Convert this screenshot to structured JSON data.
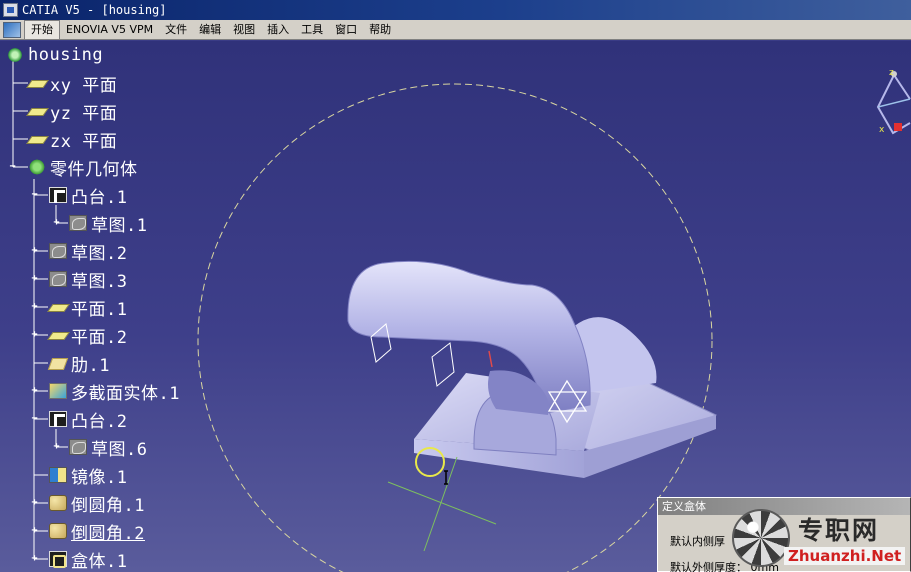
{
  "window": {
    "title": "CATIA V5 - [housing]"
  },
  "menu": {
    "items": [
      {
        "label": "开始",
        "active": true
      },
      {
        "label": "ENOVIA V5 VPM",
        "active": false
      },
      {
        "label": "文件",
        "active": false
      },
      {
        "label": "编辑",
        "active": false
      },
      {
        "label": "视图",
        "active": false
      },
      {
        "label": "插入",
        "active": false
      },
      {
        "label": "工具",
        "active": false
      },
      {
        "label": "窗口",
        "active": false
      },
      {
        "label": "帮助",
        "active": false
      }
    ]
  },
  "tree": {
    "root": "housing",
    "items": [
      {
        "label": "xy 平面",
        "icon": "plane-icon"
      },
      {
        "label": "yz 平面",
        "icon": "plane-icon"
      },
      {
        "label": "zx 平面",
        "icon": "plane-icon"
      },
      {
        "label": "零件几何体",
        "icon": "part-body-icon"
      },
      {
        "label": "凸台.1",
        "icon": "pad-icon"
      },
      {
        "label": "草图.1",
        "icon": "sketch-icon"
      },
      {
        "label": "草图.2",
        "icon": "sketch-icon"
      },
      {
        "label": "草图.3",
        "icon": "sketch-icon"
      },
      {
        "label": "平面.1",
        "icon": "plane-icon"
      },
      {
        "label": "平面.2",
        "icon": "plane-icon"
      },
      {
        "label": "肋.1",
        "icon": "rib-icon"
      },
      {
        "label": "多截面实体.1",
        "icon": "multi-section-solid-icon"
      },
      {
        "label": "凸台.2",
        "icon": "pad-icon"
      },
      {
        "label": "草图.6",
        "icon": "sketch-icon"
      },
      {
        "label": "镜像.1",
        "icon": "mirror-icon"
      },
      {
        "label": "倒圆角.1",
        "icon": "fillet-icon"
      },
      {
        "label": "倒圆角.2",
        "icon": "fillet-icon"
      },
      {
        "label": "盒体.1",
        "icon": "shell-icon"
      }
    ]
  },
  "dialog": {
    "title": "定义盒体",
    "rows": [
      "默认内侧厚",
      "默认外侧厚度： 0mm"
    ]
  },
  "watermark": {
    "text_cn": "专职网",
    "text_en": "Zhuanzhi.Net"
  },
  "compass": {
    "x_label": "x",
    "z_label": "z"
  },
  "colors": {
    "background_top": "#30327a",
    "background_bottom": "#5a5c9c",
    "part_surface": "#b9bae8",
    "tree_text": "#ffffff"
  }
}
